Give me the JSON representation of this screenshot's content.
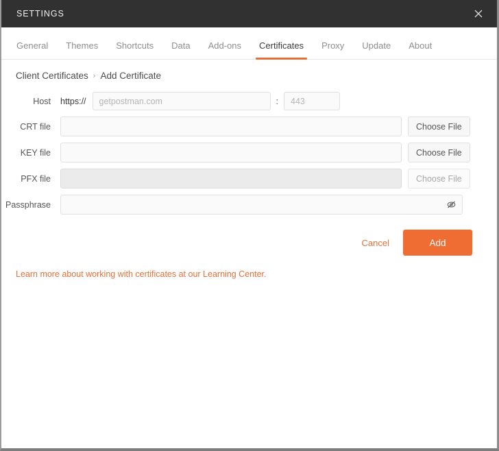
{
  "window": {
    "title": "SETTINGS",
    "close_icon": "close-icon"
  },
  "tabs": [
    {
      "label": "General",
      "active": false
    },
    {
      "label": "Themes",
      "active": false
    },
    {
      "label": "Shortcuts",
      "active": false
    },
    {
      "label": "Data",
      "active": false
    },
    {
      "label": "Add-ons",
      "active": false
    },
    {
      "label": "Certificates",
      "active": true
    },
    {
      "label": "Proxy",
      "active": false
    },
    {
      "label": "Update",
      "active": false
    },
    {
      "label": "About",
      "active": false
    }
  ],
  "breadcrumb": {
    "parent": "Client Certificates",
    "separator": "›",
    "current": "Add Certificate"
  },
  "form": {
    "host": {
      "label": "Host",
      "scheme": "https://",
      "value": "",
      "placeholder": "getpostman.com",
      "colon": ":",
      "port_value": "",
      "port_placeholder": "443"
    },
    "crt": {
      "label": "CRT file",
      "value": "",
      "placeholder": "",
      "button": "Choose File",
      "disabled": false
    },
    "key": {
      "label": "KEY file",
      "value": "",
      "placeholder": "",
      "button": "Choose File",
      "disabled": false
    },
    "pfx": {
      "label": "PFX file",
      "value": "",
      "placeholder": "",
      "button": "Choose File",
      "disabled": true
    },
    "passphrase": {
      "label": "Passphrase",
      "value": "",
      "placeholder": "",
      "reveal_icon": "eye-slash-icon"
    }
  },
  "actions": {
    "cancel_label": "Cancel",
    "add_label": "Add"
  },
  "footer": {
    "learn_more": "Learn more about working with certificates at our Learning Center."
  },
  "colors": {
    "accent": "#ef6c33",
    "accent_link": "#e4703a",
    "titlebar_bg": "#313131",
    "tab_active_text": "#3a3a3a",
    "tab_inactive_text": "#8e8e8e"
  }
}
